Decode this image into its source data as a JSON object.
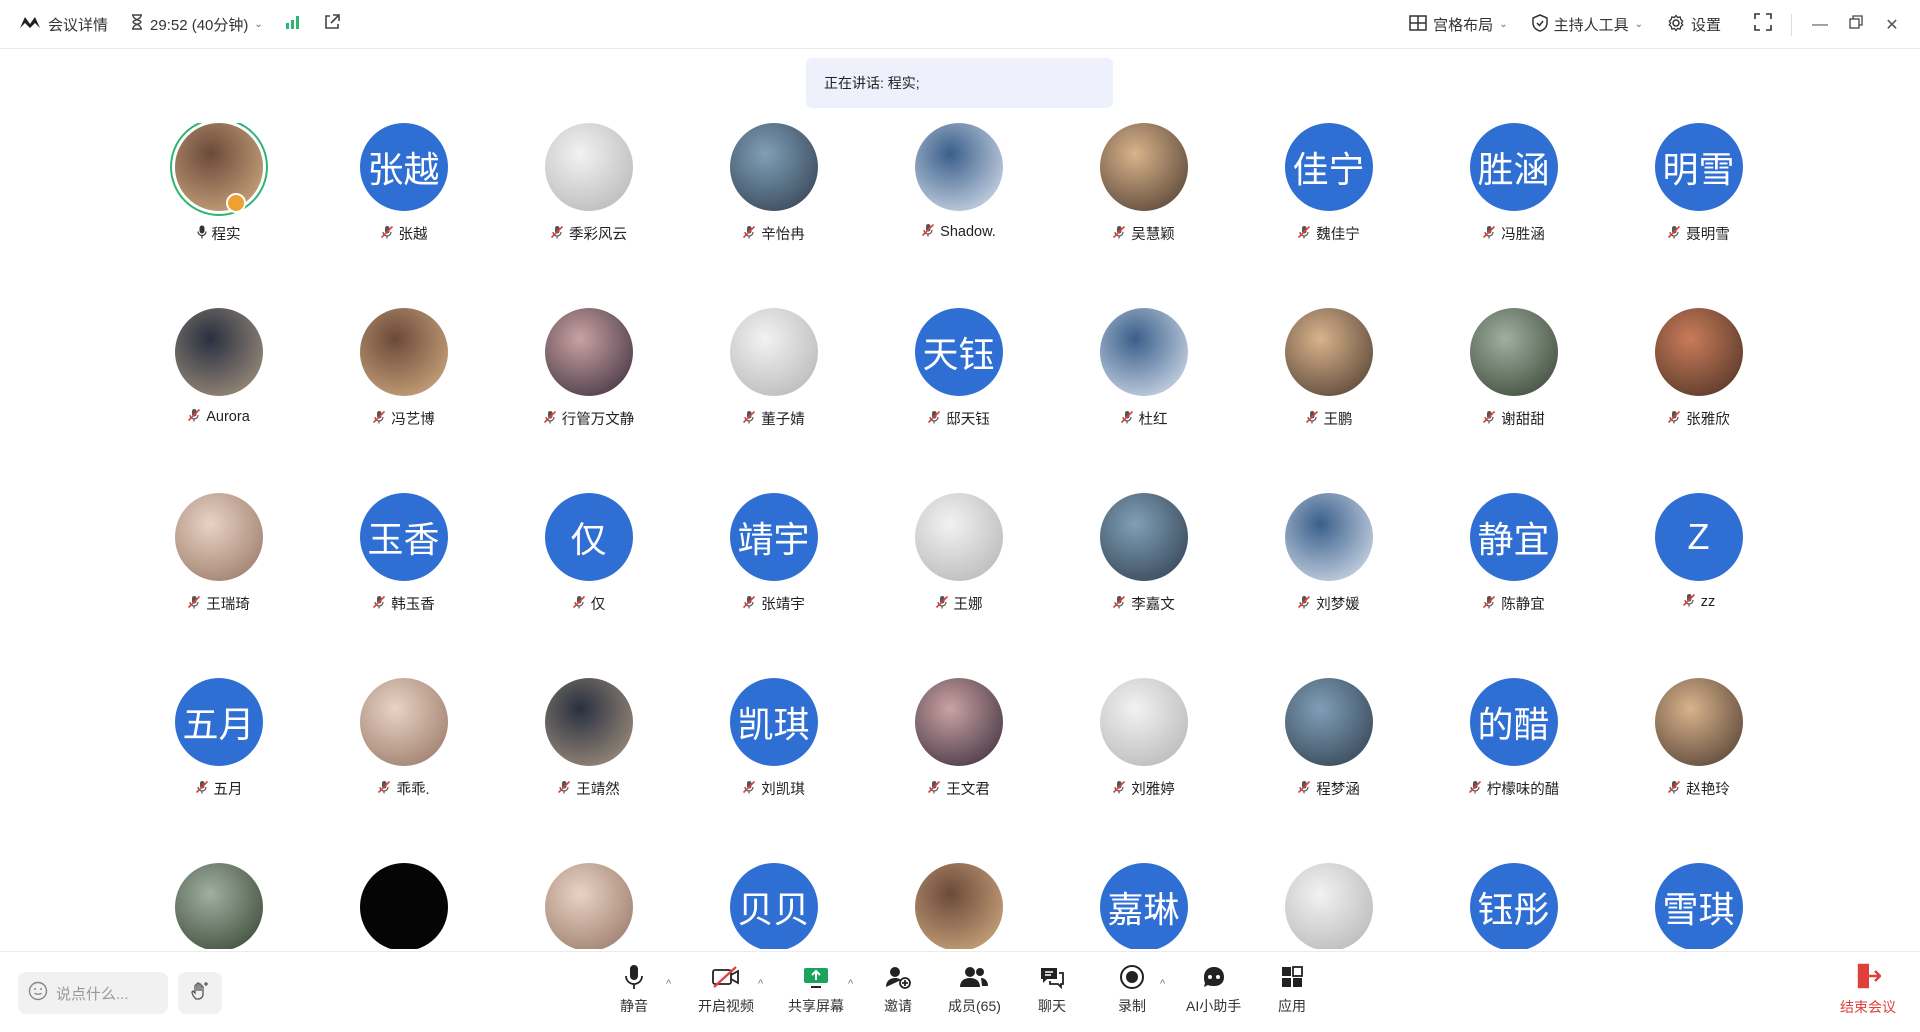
{
  "topbar": {
    "meeting_details": "会议详情",
    "timer": "29:52 (40分钟)",
    "layout": "宫格布局",
    "host_tools": "主持人工具",
    "settings": "设置"
  },
  "speaking_banner": "正在讲话: 程实;",
  "participants": [
    {
      "name": "程实",
      "avatar": "photo",
      "mic": "on",
      "speaking": true,
      "host": true
    },
    {
      "name": "张越",
      "avatar_text": "张越",
      "mic": "off"
    },
    {
      "name": "季彩风云",
      "avatar": "photo",
      "mic": "off"
    },
    {
      "name": "辛怡冉",
      "avatar": "photo",
      "mic": "off"
    },
    {
      "name": "Shadow.",
      "avatar": "photo",
      "mic": "off"
    },
    {
      "name": "吴慧颖",
      "avatar": "photo",
      "mic": "off"
    },
    {
      "name": "魏佳宁",
      "avatar_text": "佳宁",
      "mic": "off"
    },
    {
      "name": "冯胜涵",
      "avatar_text": "胜涵",
      "mic": "off"
    },
    {
      "name": "聂明雪",
      "avatar_text": "明雪",
      "mic": "off"
    },
    {
      "name": "Aurora",
      "avatar": "photo",
      "mic": "off"
    },
    {
      "name": "冯艺博",
      "avatar": "photo",
      "mic": "off"
    },
    {
      "name": "行管万文静",
      "avatar": "photo",
      "mic": "off"
    },
    {
      "name": "董子婧",
      "avatar": "photo",
      "mic": "off"
    },
    {
      "name": "邸天钰",
      "avatar_text": "天钰",
      "mic": "off"
    },
    {
      "name": "杜红",
      "avatar": "photo",
      "mic": "off"
    },
    {
      "name": "王鹏",
      "avatar": "photo",
      "mic": "off"
    },
    {
      "name": "谢甜甜",
      "avatar": "photo",
      "mic": "off"
    },
    {
      "name": "张雅欣",
      "avatar": "photo",
      "mic": "off"
    },
    {
      "name": "王瑞琦",
      "avatar": "photo",
      "mic": "off"
    },
    {
      "name": "韩玉香",
      "avatar_text": "玉香",
      "mic": "off"
    },
    {
      "name": "仅",
      "avatar_text": "仅",
      "mic": "off"
    },
    {
      "name": "张靖宇",
      "avatar_text": "靖宇",
      "mic": "off"
    },
    {
      "name": "王娜",
      "avatar": "photo",
      "mic": "off"
    },
    {
      "name": "李嘉文",
      "avatar": "photo",
      "mic": "off"
    },
    {
      "name": "刘梦媛",
      "avatar": "photo",
      "mic": "off"
    },
    {
      "name": "陈静宜",
      "avatar_text": "静宜",
      "mic": "off"
    },
    {
      "name": "zz",
      "avatar_text": "Z",
      "mic": "off"
    },
    {
      "name": "五月",
      "avatar_text": "五月",
      "mic": "off"
    },
    {
      "name": "乖乖.",
      "avatar": "photo",
      "mic": "off"
    },
    {
      "name": "王靖然",
      "avatar": "photo",
      "mic": "off"
    },
    {
      "name": "刘凯琪",
      "avatar_text": "凯琪",
      "mic": "off"
    },
    {
      "name": "王文君",
      "avatar": "photo",
      "mic": "off"
    },
    {
      "name": "刘雅婷",
      "avatar": "photo",
      "mic": "off"
    },
    {
      "name": "程梦涵",
      "avatar": "photo",
      "mic": "off"
    },
    {
      "name": "柠檬味的醋",
      "avatar_text": "的醋",
      "mic": "off"
    },
    {
      "name": "赵艳玲",
      "avatar": "photo",
      "mic": "off"
    },
    {
      "name": "",
      "avatar": "photo",
      "mic": "off"
    },
    {
      "name": "",
      "avatar": "photo",
      "mic": "off"
    },
    {
      "name": "",
      "avatar": "photo",
      "mic": "off"
    },
    {
      "name": "",
      "avatar_text": "贝贝",
      "mic": "off"
    },
    {
      "name": "",
      "avatar": "photo",
      "mic": "off"
    },
    {
      "name": "",
      "avatar_text": "嘉琳",
      "mic": "off"
    },
    {
      "name": "",
      "avatar": "photo",
      "mic": "off"
    },
    {
      "name": "",
      "avatar_text": "钰彤",
      "mic": "off"
    },
    {
      "name": "",
      "avatar_text": "雪琪",
      "mic": "off"
    }
  ],
  "bottombar": {
    "chat_placeholder": "说点什么...",
    "mute": "静音",
    "start_video": "开启视频",
    "share_screen": "共享屏幕",
    "invite": "邀请",
    "members": "成员(65)",
    "chat": "聊天",
    "record": "录制",
    "ai_assistant": "AI小助手",
    "apps": "应用",
    "end_meeting": "结束会议"
  },
  "colors": {
    "avatar_blue": "#2f6fd4",
    "speaking_ring": "#2bb673",
    "end_red": "#e0403a",
    "share_green": "#1aa260"
  }
}
